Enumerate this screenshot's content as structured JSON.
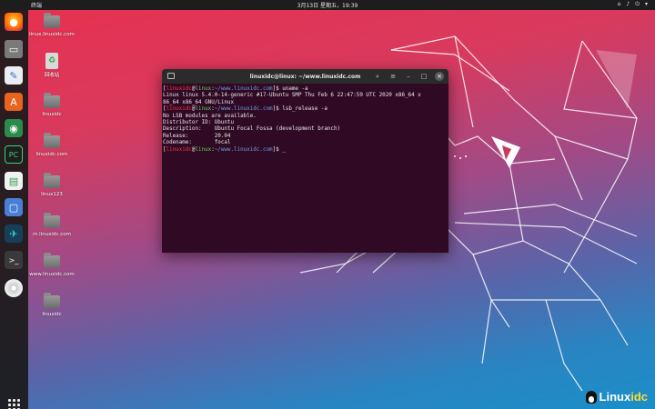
{
  "topbar": {
    "activities_label": "终端",
    "clock": "3月13日 星期五，19:39",
    "tray_icons": [
      "network-icon",
      "volume-icon",
      "power-icon",
      "menu-icon"
    ]
  },
  "dock": {
    "apps": [
      "firefox",
      "files",
      "text-editor",
      "software",
      "android-studio",
      "pycharm",
      "system-monitor",
      "screenshot",
      "pycharm-edu",
      "terminal",
      "optical-disc"
    ]
  },
  "desktop": {
    "icons": [
      {
        "label": "linux.linuxidc.com",
        "kind": "folder"
      },
      {
        "label": "回收站",
        "kind": "trash"
      },
      {
        "label": "linuxidc",
        "kind": "folder"
      },
      {
        "label": "linuxidc.com",
        "kind": "folder"
      },
      {
        "label": "linux123",
        "kind": "folder"
      },
      {
        "label": "m.linuxidc.com",
        "kind": "folder"
      },
      {
        "label": "www.linuxidc.com",
        "kind": "folder"
      },
      {
        "label": "linuxidc",
        "kind": "folder"
      }
    ]
  },
  "terminal": {
    "title": "linuxidc@linux: ~/www.linuxidc.com",
    "prompt_user": "linuxidc",
    "prompt_host": "linux",
    "prompt_path": "~/www.linuxidc.com",
    "lines": {
      "cmd1": "uname -a",
      "out1a": "Linux linux 5.4.0-14-generic #17-Ubuntu SMP Thu Feb 6 22:47:59 UTC 2020 x86_64 x",
      "out1b": "86_64 x86_64 GNU/Linux",
      "cmd2": "lsb_release -a",
      "out2a": "No LSB modules are available.",
      "out2b": "Distributor ID:\tUbuntu",
      "out2c": "Description:\tUbuntu Focal Fossa (development branch)",
      "out2d": "Release:\t20.04",
      "out2e": "Codename:\tfocal",
      "cmd3": "_"
    }
  },
  "watermark": {
    "text_main": "Linux",
    "text_accent": "idc",
    "sub": "www.Linuxidc.com"
  },
  "colors": {
    "terminal_bg": "#300a24",
    "dock_bg": "#1a1a1a",
    "wallpaper_top": "#e8304f",
    "wallpaper_bottom": "#1a8fc8"
  }
}
